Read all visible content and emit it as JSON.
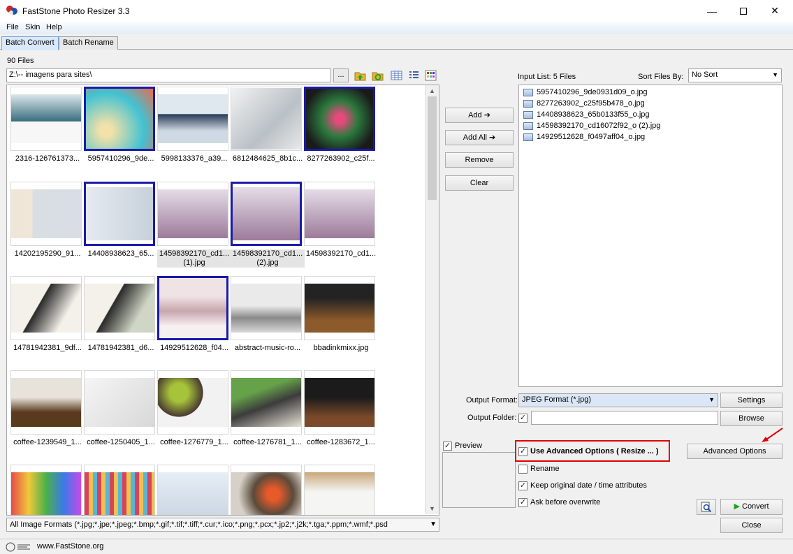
{
  "window": {
    "title": "FastStone Photo Resizer 3.3"
  },
  "menu": [
    "File",
    "Skin",
    "Help"
  ],
  "tabs": [
    {
      "label": "Batch Convert",
      "active": true
    },
    {
      "label": "Batch Rename",
      "active": false
    }
  ],
  "file_count": "90 Files",
  "path": "Z:\\-- imagens para sites\\",
  "browse_dots": "...",
  "thumbnails": [
    {
      "label": "2316-126761373...",
      "selected": false
    },
    {
      "label": "5957410296_9de...",
      "selected": true
    },
    {
      "label": "5998133376_a39...",
      "selected": false
    },
    {
      "label": "6812484625_8b1c...",
      "selected": false
    },
    {
      "label": "8277263902_c25f...",
      "selected": true
    },
    {
      "label": "14202195290_91...",
      "selected": false
    },
    {
      "label": "14408938623_65...",
      "selected": true
    },
    {
      "label": "14598392170_cd1...",
      "label2": "(1).jpg",
      "selected": false
    },
    {
      "label": "14598392170_cd1...",
      "label2": "(2).jpg",
      "selected": true
    },
    {
      "label": "14598392170_cd1...",
      "selected": false
    },
    {
      "label": "14781942381_9df...",
      "selected": false
    },
    {
      "label": "14781942381_d6...",
      "selected": false
    },
    {
      "label": "14929512628_f04...",
      "selected": true
    },
    {
      "label": "abstract-music-ro...",
      "selected": false
    },
    {
      "label": "bbadinkmixx.jpg",
      "selected": false
    },
    {
      "label": "coffee-1239549_1...",
      "selected": false
    },
    {
      "label": "coffee-1250405_1...",
      "selected": false
    },
    {
      "label": "coffee-1276779_1...",
      "selected": false
    },
    {
      "label": "coffee-1276781_1...",
      "selected": false
    },
    {
      "label": "coffee-1283672_1...",
      "selected": false
    },
    {
      "label": "",
      "selected": false
    },
    {
      "label": "",
      "selected": false
    },
    {
      "label": "",
      "selected": false
    },
    {
      "label": "",
      "selected": false
    },
    {
      "label": "",
      "selected": false
    }
  ],
  "format_filter": "All Image Formats (*.jpg;*.jpe;*.jpeg;*.bmp;*.gif;*.tif;*.tiff;*.cur;*.ico;*.png;*.pcx;*.jp2;*.j2k;*.tga;*.ppm;*.wmf;*.psd",
  "buttons": {
    "add": "Add",
    "add_all": "Add All",
    "remove": "Remove",
    "clear": "Clear",
    "settings": "Settings",
    "browse": "Browse",
    "advanced_options": "Advanced Options",
    "convert": "Convert",
    "close": "Close"
  },
  "input_list": {
    "label": "Input List:  5 Files",
    "files": [
      "5957410296_9de0931d09_o.jpg",
      "8277263902_c25f95b478_o.jpg",
      "14408938623_65b0133f55_o.jpg",
      "14598392170_cd16072f92_o (2).jpg",
      "14929512628_f0497aff04_o.jpg"
    ]
  },
  "sort": {
    "label": "Sort Files By:",
    "value": "No Sort"
  },
  "output": {
    "format_label": "Output Format:",
    "format_value": "JPEG Format (*.jpg)",
    "folder_label": "Output Folder:",
    "folder_value": ""
  },
  "options": {
    "preview": "Preview",
    "use_advanced": "Use Advanced Options ( Resize ... )",
    "rename": "Rename",
    "keep_date": "Keep original date / time attributes",
    "ask_overwrite": "Ask before overwrite"
  },
  "status": {
    "url": "www.FastStone.org"
  }
}
